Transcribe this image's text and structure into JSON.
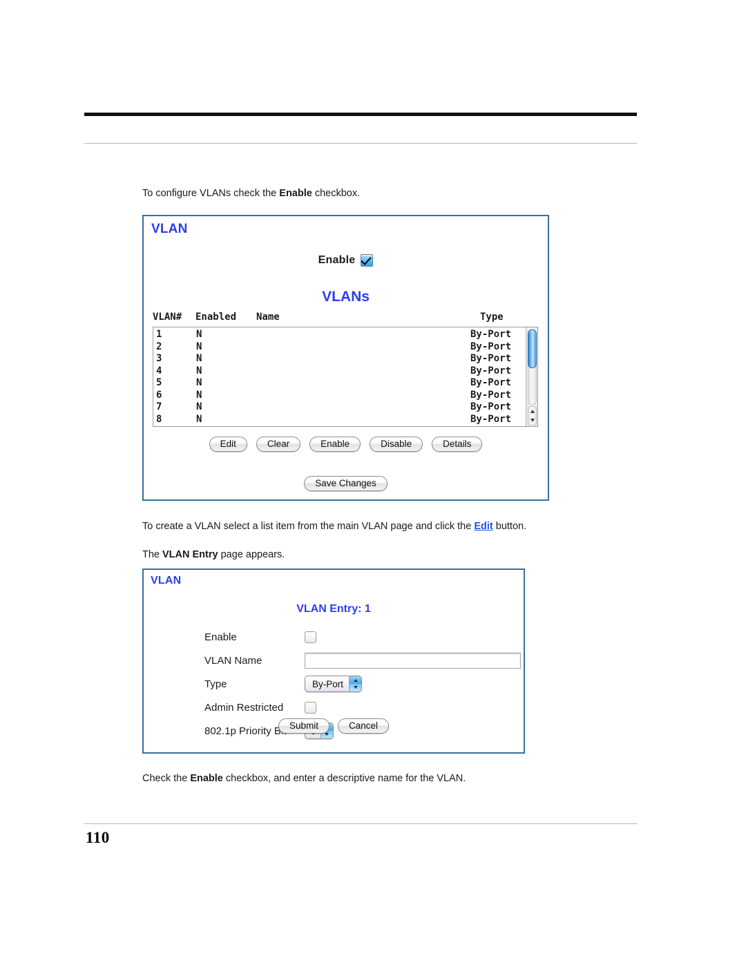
{
  "document": {
    "page_number": "110",
    "paragraphs": {
      "p1_before": "To configure VLANs check the ",
      "p1_bold": "Enable",
      "p1_after": " checkbox.",
      "p2_before": "To create a VLAN select a list item from the main VLAN page and click the ",
      "p2_link": "Edit",
      "p2_after": " button.",
      "p3_before": "The ",
      "p3_bold": "VLAN Entry",
      "p3_after": " page appears.",
      "p4_before": "Check the ",
      "p4_bold": "Enable",
      "p4_after": " checkbox, and enter a descriptive name for the VLAN."
    }
  },
  "colors": {
    "panel_border": "#35709e",
    "heading_blue": "#2b3df0",
    "link_blue": "#1a55e8",
    "checkbox_checked": "#3b9fe6"
  },
  "vlan_list_panel": {
    "title": "VLAN",
    "enable_label": "Enable",
    "enable_checked": true,
    "section_heading": "VLANs",
    "columns": [
      "VLAN#",
      "Enabled",
      "Name",
      "Type"
    ],
    "rows": [
      {
        "num": "1",
        "enabled": "N",
        "name": "",
        "type": "By-Port"
      },
      {
        "num": "2",
        "enabled": "N",
        "name": "",
        "type": "By-Port"
      },
      {
        "num": "3",
        "enabled": "N",
        "name": "",
        "type": "By-Port"
      },
      {
        "num": "4",
        "enabled": "N",
        "name": "",
        "type": "By-Port"
      },
      {
        "num": "5",
        "enabled": "N",
        "name": "",
        "type": "By-Port"
      },
      {
        "num": "6",
        "enabled": "N",
        "name": "",
        "type": "By-Port"
      },
      {
        "num": "7",
        "enabled": "N",
        "name": "",
        "type": "By-Port"
      },
      {
        "num": "8",
        "enabled": "N",
        "name": "",
        "type": "By-Port"
      }
    ],
    "action_buttons": [
      "Edit",
      "Clear",
      "Enable",
      "Disable",
      "Details"
    ],
    "save_button": "Save Changes"
  },
  "vlan_entry_panel": {
    "title": "VLAN",
    "heading_label": "VLAN Entry:",
    "heading_value": "1",
    "heading_full": "VLAN Entry: 1",
    "fields": {
      "enable_label": "Enable",
      "enable_checked": false,
      "name_label": "VLAN Name",
      "name_value": "",
      "type_label": "Type",
      "type_value": "By-Port",
      "admin_restricted_label": "Admin Restricted",
      "admin_restricted_checked": false,
      "priority_label": "802.1p Priority Bit",
      "priority_value": "0"
    },
    "submit_button": "Submit",
    "cancel_button": "Cancel"
  }
}
